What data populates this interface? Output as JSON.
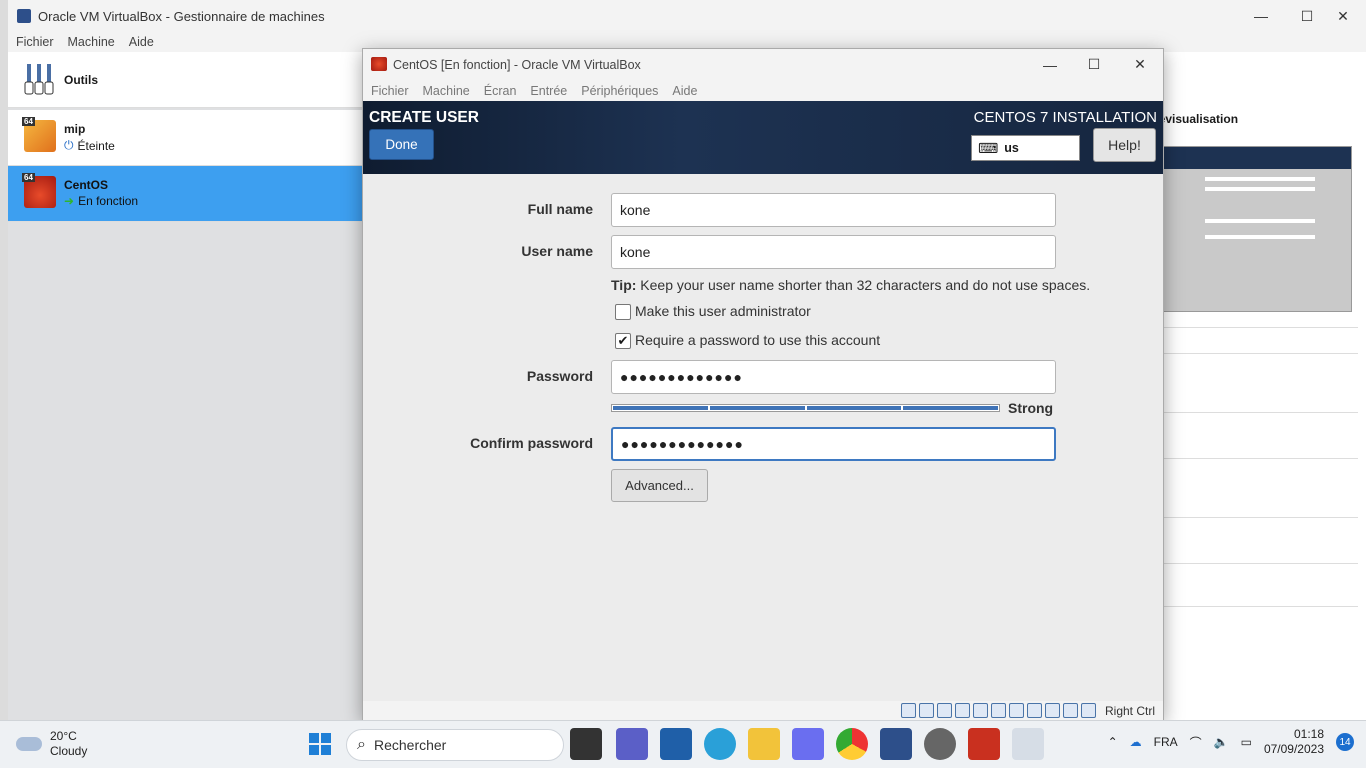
{
  "manager": {
    "title": "Oracle VM VirtualBox - Gestionnaire de machines",
    "menu": [
      "Fichier",
      "Machine",
      "Aide"
    ],
    "tools_label": "Outils",
    "vms": [
      {
        "name": "mip",
        "state": "Éteinte",
        "arch_badge": "64"
      },
      {
        "name": "CentOS",
        "state": "En fonction",
        "arch_badge": "64"
      }
    ],
    "preview_title": "révisualisation"
  },
  "vm_window": {
    "title": "CentOS [En fonction] - Oracle VM VirtualBox",
    "menu": [
      "Fichier",
      "Machine",
      "Écran",
      "Entrée",
      "Périphériques",
      "Aide"
    ],
    "host_key": "Right Ctrl"
  },
  "installer": {
    "screen_title": "CREATE USER",
    "product_title": "CENTOS 7 INSTALLATION",
    "done_label": "Done",
    "keyboard_layout": "us",
    "help_label": "Help!",
    "full_name_label": "Full name",
    "full_name_value": "kone",
    "user_name_label": "User name",
    "user_name_value": "kone",
    "tip_prefix": "Tip:",
    "tip_text": " Keep your user name shorter than 32 characters and do not use spaces.",
    "admin_label": "Make this user administrator",
    "admin_checked": false,
    "require_password_label": "Require a password to use this account",
    "require_password_checked": true,
    "password_label": "Password",
    "password_value": "●●●●●●●●●●●●●",
    "strength_label": "Strong",
    "strength_level": 1.0,
    "confirm_label": "Confirm password",
    "confirm_value": "●●●●●●●●●●●●●",
    "advanced_label": "Advanced..."
  },
  "taskbar": {
    "weather_temp": "20°C",
    "weather_desc": "Cloudy",
    "search_placeholder": "Rechercher",
    "language": "FRA",
    "time": "01:18",
    "date": "07/09/2023",
    "notification_count": "14"
  },
  "icons": [
    "virtualbox-icon",
    "windows-start-icon",
    "search-icon",
    "file-explorer-icon",
    "chrome-icon",
    "edge-icon",
    "settings-icon",
    "wifi-icon",
    "volume-icon",
    "battery-icon",
    "cloud-icon",
    "keyboard-icon"
  ]
}
